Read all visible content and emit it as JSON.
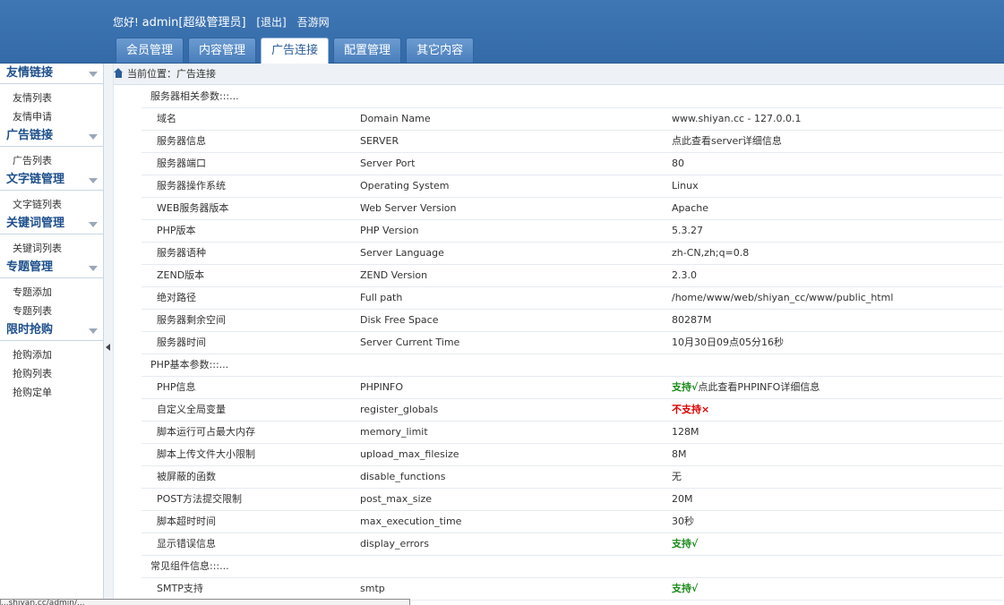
{
  "header": {
    "greeting": "您好!",
    "user": "admin[超级管理员]",
    "logout": "[退出]",
    "site": "吾游网",
    "tabs": [
      "会员管理",
      "内容管理",
      "广告连接",
      "配置管理",
      "其它内容"
    ],
    "active_tab": 2
  },
  "sidebar": {
    "groups": [
      {
        "title": "友情链接",
        "items": [
          "友情列表",
          "友情申请"
        ]
      },
      {
        "title": "广告链接",
        "items": [
          "广告列表"
        ]
      },
      {
        "title": "文字链管理",
        "items": [
          "文字链列表"
        ]
      },
      {
        "title": "关键词管理",
        "items": [
          "关键词列表"
        ]
      },
      {
        "title": "专题管理",
        "items": [
          "专题添加",
          "专题列表"
        ]
      },
      {
        "title": "限时抢购",
        "items": [
          "抢购添加",
          "抢购列表",
          "抢购定单"
        ]
      }
    ]
  },
  "breadcrumb": "当前位置：广告连接",
  "sections": [
    {
      "title": "服务器相关参数:::...",
      "rows": [
        [
          "域名",
          "Domain Name",
          "www.shiyan.cc - 127.0.0.1"
        ],
        [
          "服务器信息",
          "SERVER",
          "点此查看server详细信息"
        ],
        [
          "服务器端口",
          "Server Port",
          "80"
        ],
        [
          "服务器操作系统",
          "Operating System",
          "Linux"
        ],
        [
          "WEB服务器版本",
          "Web Server Version",
          "Apache"
        ],
        [
          "PHP版本",
          "PHP Version",
          "5.3.27"
        ],
        [
          "服务器语种",
          "Server Language",
          "zh-CN,zh;q=0.8"
        ],
        [
          "ZEND版本",
          "ZEND Version",
          "2.3.0"
        ],
        [
          "绝对路径",
          "Full path",
          "/home/www/web/shiyan_cc/www/public_html"
        ],
        [
          "服务器剩余空间",
          "Disk Free Space",
          "80287M"
        ],
        [
          "服务器时间",
          "Server Current Time",
          "10月30日09点05分16秒"
        ]
      ]
    },
    {
      "title": "PHP基本参数:::...",
      "rows": [
        [
          "PHP信息",
          "PHPINFO",
          "支持√",
          "点此查看PHPINFO详细信息"
        ],
        [
          "自定义全局变量",
          "register_globals",
          "不支持×"
        ],
        [
          "脚本运行可占最大内存",
          "memory_limit",
          "128M"
        ],
        [
          "脚本上传文件大小限制",
          "upload_max_filesize",
          "8M"
        ],
        [
          "被屏蔽的函数",
          "disable_functions",
          "无"
        ],
        [
          "POST方法提交限制",
          "post_max_size",
          "20M"
        ],
        [
          "脚本超时时间",
          "max_execution_time",
          "30秒"
        ],
        [
          "显示错误信息",
          "display_errors",
          "支持√"
        ]
      ]
    },
    {
      "title": "常见组件信息:::...",
      "rows": [
        [
          "SMTP支持",
          "smtp",
          "支持√"
        ]
      ]
    }
  ],
  "statusbar": "...shiyan.cc/admin/...",
  "colors": {
    "support": "#1b8a1b",
    "nosupport": "#dd0000",
    "header": "#3a72b0"
  }
}
